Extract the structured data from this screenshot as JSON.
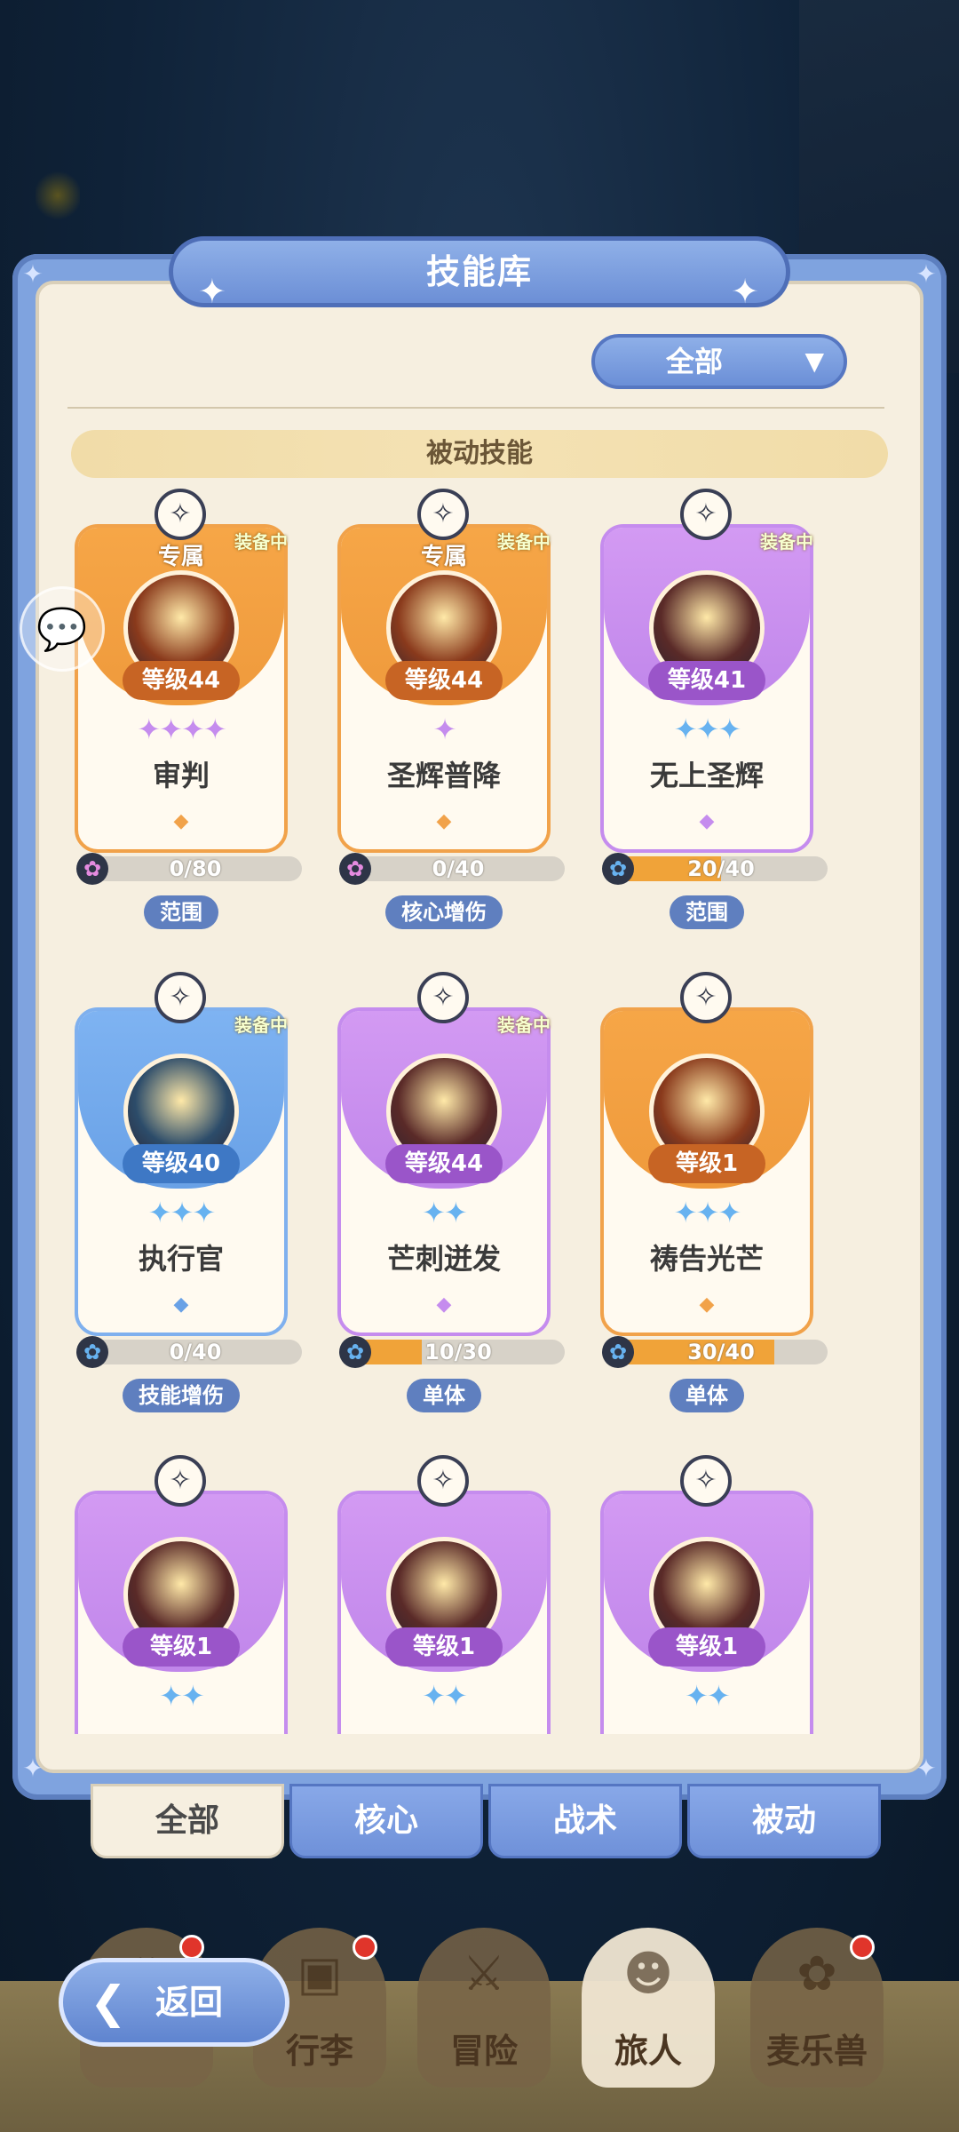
{
  "window": {
    "title": "技能库"
  },
  "filter": {
    "selected": "全部"
  },
  "section": {
    "title": "被动技能"
  },
  "cards": [
    {
      "theme": "orange",
      "equipped": "装备中",
      "exclusive": "专属",
      "level": "等级44",
      "stars": "✦✦✦✦",
      "star_color": "#c58cee",
      "name": "审判",
      "progress": "0/80",
      "progress_pct": 0,
      "chip_color": "#e58be0",
      "tag": "范围"
    },
    {
      "theme": "orange",
      "equipped": "装备中",
      "exclusive": "专属",
      "level": "等级44",
      "stars": "✦",
      "star_color": "#c58cee",
      "name": "圣辉普降",
      "progress": "0/40",
      "progress_pct": 0,
      "chip_color": "#e58be0",
      "tag": "核心增伤"
    },
    {
      "theme": "purple",
      "equipped": "装备中",
      "exclusive": "",
      "level": "等级41",
      "stars": "✦✦✦",
      "star_color": "#67b2f0",
      "name": "无上圣辉",
      "progress": "20/40",
      "progress_pct": 50,
      "chip_color": "#67b2f0",
      "tag": "范围"
    },
    {
      "theme": "blue",
      "equipped": "装备中",
      "exclusive": "",
      "level": "等级40",
      "stars": "✦✦✦",
      "star_color": "#67b2f0",
      "name": "执行官",
      "progress": "0/40",
      "progress_pct": 0,
      "chip_color": "#67b2f0",
      "tag": "技能增伤"
    },
    {
      "theme": "purple",
      "equipped": "装备中",
      "exclusive": "",
      "level": "等级44",
      "stars": "✦✦",
      "star_color": "#67b2f0",
      "name": "芒刺迸发",
      "progress": "10/30",
      "progress_pct": 33,
      "chip_color": "#67b2f0",
      "tag": "单体"
    },
    {
      "theme": "orange",
      "equipped": "",
      "exclusive": "",
      "level": "等级1",
      "stars": "✦✦✦",
      "star_color": "#67b2f0",
      "name": "祷告光芒",
      "progress": "30/40",
      "progress_pct": 75,
      "chip_color": "#67b2f0",
      "tag": "单体"
    },
    {
      "theme": "purple",
      "equipped": "",
      "exclusive": "",
      "level": "等级1",
      "stars": "✦✦",
      "star_color": "#67b2f0",
      "name": "",
      "progress": "",
      "progress_pct": 0,
      "chip_color": "#67b2f0",
      "tag": ""
    },
    {
      "theme": "purple",
      "equipped": "",
      "exclusive": "",
      "level": "等级1",
      "stars": "✦✦",
      "star_color": "#67b2f0",
      "name": "",
      "progress": "",
      "progress_pct": 0,
      "chip_color": "#67b2f0",
      "tag": ""
    },
    {
      "theme": "purple",
      "equipped": "",
      "exclusive": "",
      "level": "等级1",
      "stars": "✦✦",
      "star_color": "#67b2f0",
      "name": "",
      "progress": "",
      "progress_pct": 0,
      "chip_color": "#67b2f0",
      "tag": ""
    }
  ],
  "tabs": [
    {
      "label": "全部",
      "active": true
    },
    {
      "label": "核心",
      "active": false
    },
    {
      "label": "战术",
      "active": false
    },
    {
      "label": "被动",
      "active": false
    }
  ],
  "nav": [
    {
      "label": "",
      "icon": "backpack-icon",
      "red_dot": true
    },
    {
      "label": "行李",
      "icon": "chest-icon",
      "red_dot": true
    },
    {
      "label": "冒险",
      "icon": "swords-icon",
      "red_dot": false
    },
    {
      "label": "旅人",
      "icon": "hero-icon",
      "red_dot": false,
      "selected": true
    },
    {
      "label": "麦乐兽",
      "icon": "pet-icon",
      "red_dot": true
    }
  ],
  "back_button": {
    "label": "返回"
  },
  "icons": {
    "title_deco": "sparkle-icon",
    "dropdown_arrow": "▼",
    "card_gem": "✧",
    "chat": "chat-bubble-icon",
    "back": "back-arrow-icon"
  },
  "colors": {
    "accent_blue": "#6f91d9",
    "panel_bg": "#f6efe0",
    "progress_fill": "#f0a339"
  }
}
